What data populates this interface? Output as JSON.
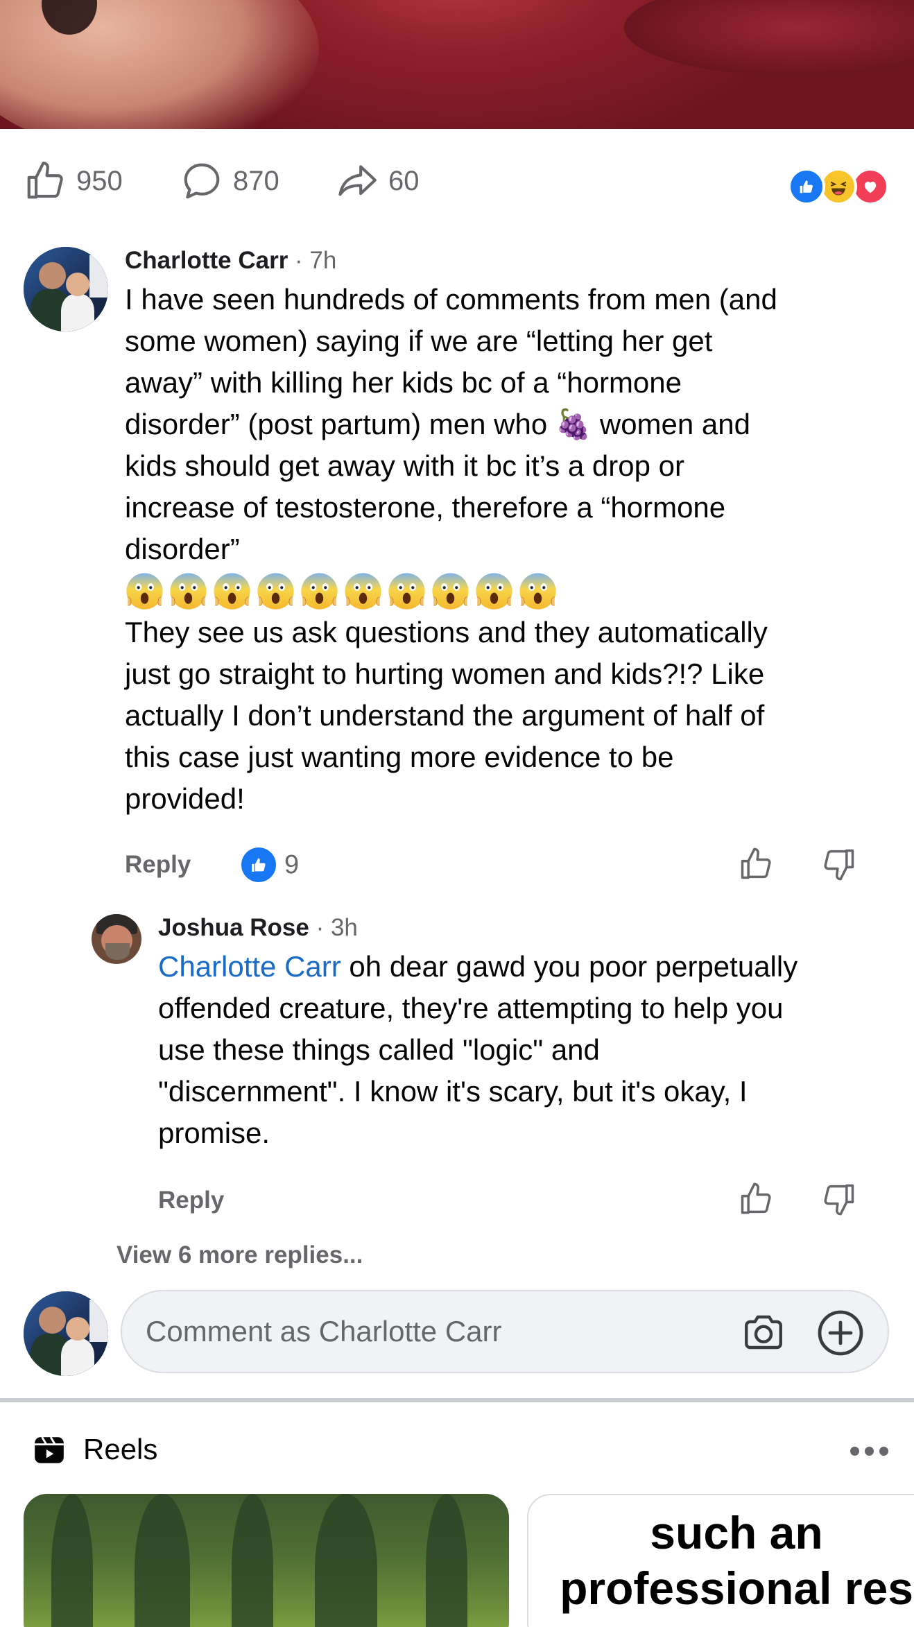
{
  "post": {
    "stats": {
      "likes": "950",
      "comments": "870",
      "shares": "60"
    },
    "reaction_icons": [
      "like-icon",
      "haha-icon",
      "love-icon"
    ]
  },
  "comments": [
    {
      "author": "Charlotte Carr",
      "time": " · 7h",
      "lines_part1": [
        "I have seen hundreds of comments from men (and",
        "some women) saying if we are “letting her get",
        "away” with killing her kids bc of a “hormone",
        "disorder” (post partum) men who 🍇 women and",
        "kids should get away with it bc it’s a drop or",
        "increase of testosterone, therefore a “hormone",
        "disorder”"
      ],
      "emoji_count": 10,
      "emoji_icon": "screaming-face-emoji",
      "lines_part2": [
        "They see us ask questions and they automatically",
        "just go straight to hurting women and kids?!? Like",
        "actually I don’t understand the argument of half of",
        "this case just wanting more evidence to be",
        "provided!"
      ],
      "reply_label": "Reply",
      "like_count": "9"
    },
    {
      "author": "Joshua Rose",
      "time": " · 3h",
      "mention": "Charlotte Carr",
      "line1_rest": " oh dear gawd you poor perpetually",
      "lines": [
        "offended creature, they're attempting to help you",
        "use these things called \"logic\" and",
        "\"discernment\".  I know it's scary, but it's okay, I",
        "promise."
      ],
      "reply_label": "Reply"
    }
  ],
  "view_more": "View 6 more replies...",
  "composer": {
    "placeholder": "Comment as Charlotte Carr"
  },
  "reels": {
    "title": "Reels",
    "card2_lines": [
      "such an",
      "professional res"
    ]
  },
  "colors": {
    "accent": "#1877f2",
    "mention": "#1a6ac7",
    "secondary_text": "#65676b"
  }
}
